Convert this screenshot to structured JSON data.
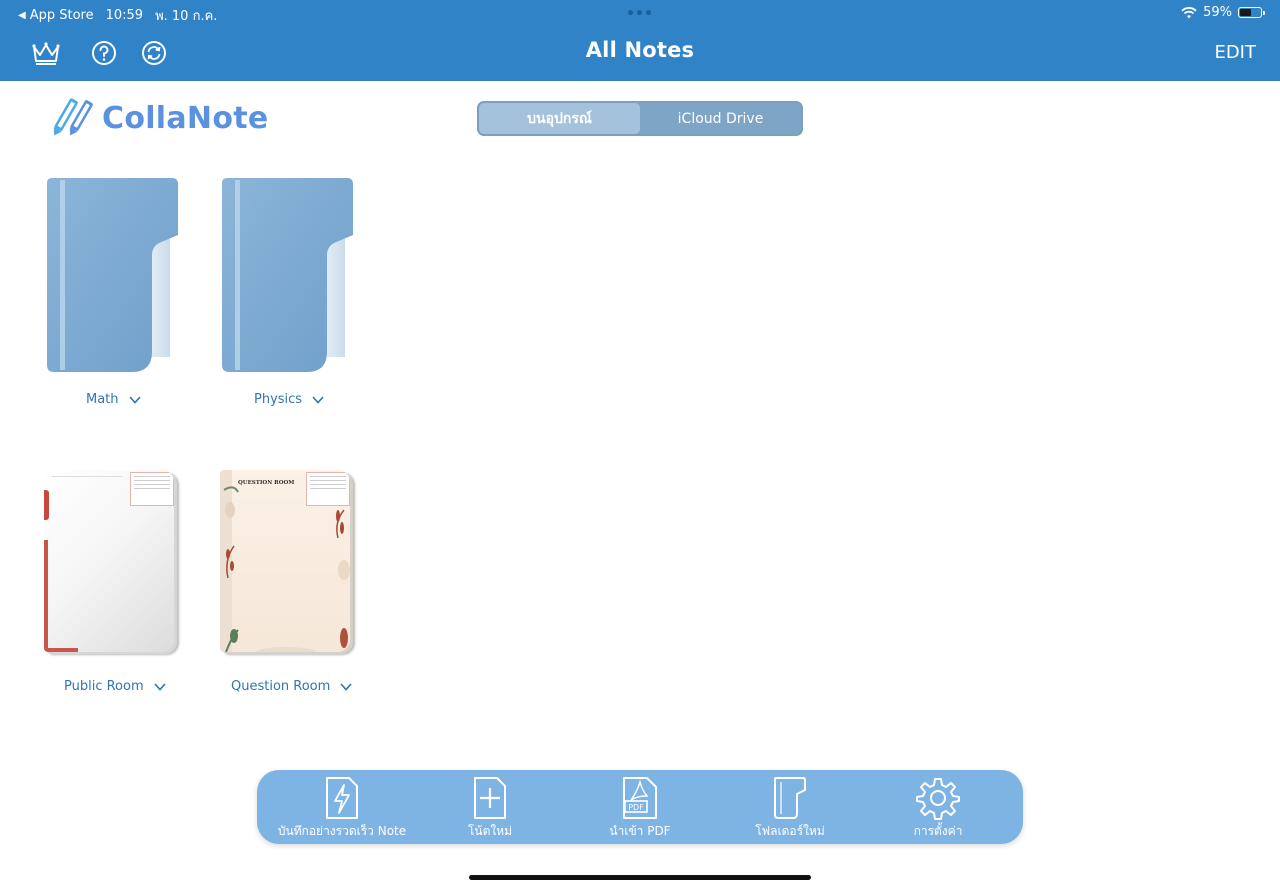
{
  "status": {
    "back_app": "App Store",
    "time": "10:59",
    "date": "พ. 10 ก.ค.",
    "battery": "59%",
    "battery_level": 0.59
  },
  "nav": {
    "title": "All Notes",
    "edit": "EDIT",
    "icons": [
      "crown-icon",
      "help-icon",
      "sync-icon"
    ]
  },
  "logo": {
    "text": "CollaNote"
  },
  "segment": {
    "options": [
      "บนอุปกรณ์",
      "iCloud Drive"
    ],
    "selected": "บนอุปกรณ์"
  },
  "folders": [
    {
      "name": "Math"
    },
    {
      "name": "Physics"
    }
  ],
  "notebooks": [
    {
      "name": "Public Room"
    },
    {
      "name": "Question Room",
      "cover_title": "QUESTION ROOM"
    }
  ],
  "toolbar": {
    "items": [
      {
        "label": "บันทึกอย่างรวดเร็ว Note",
        "icon": "quick-note-icon"
      },
      {
        "label": "โน้ตใหม่",
        "icon": "new-note-icon"
      },
      {
        "label": "นำเข้า PDF",
        "icon": "import-pdf-icon",
        "badge": "PDF"
      },
      {
        "label": "โฟลเดอร์ใหม่",
        "icon": "new-folder-icon"
      },
      {
        "label": "การตั้งค่า",
        "icon": "settings-icon"
      }
    ]
  },
  "colors": {
    "nav_bar": "#2f83c6",
    "folder": "#7aa9d2",
    "accent_text": "#2f76b3",
    "toolbar": "#7eb4e3"
  }
}
